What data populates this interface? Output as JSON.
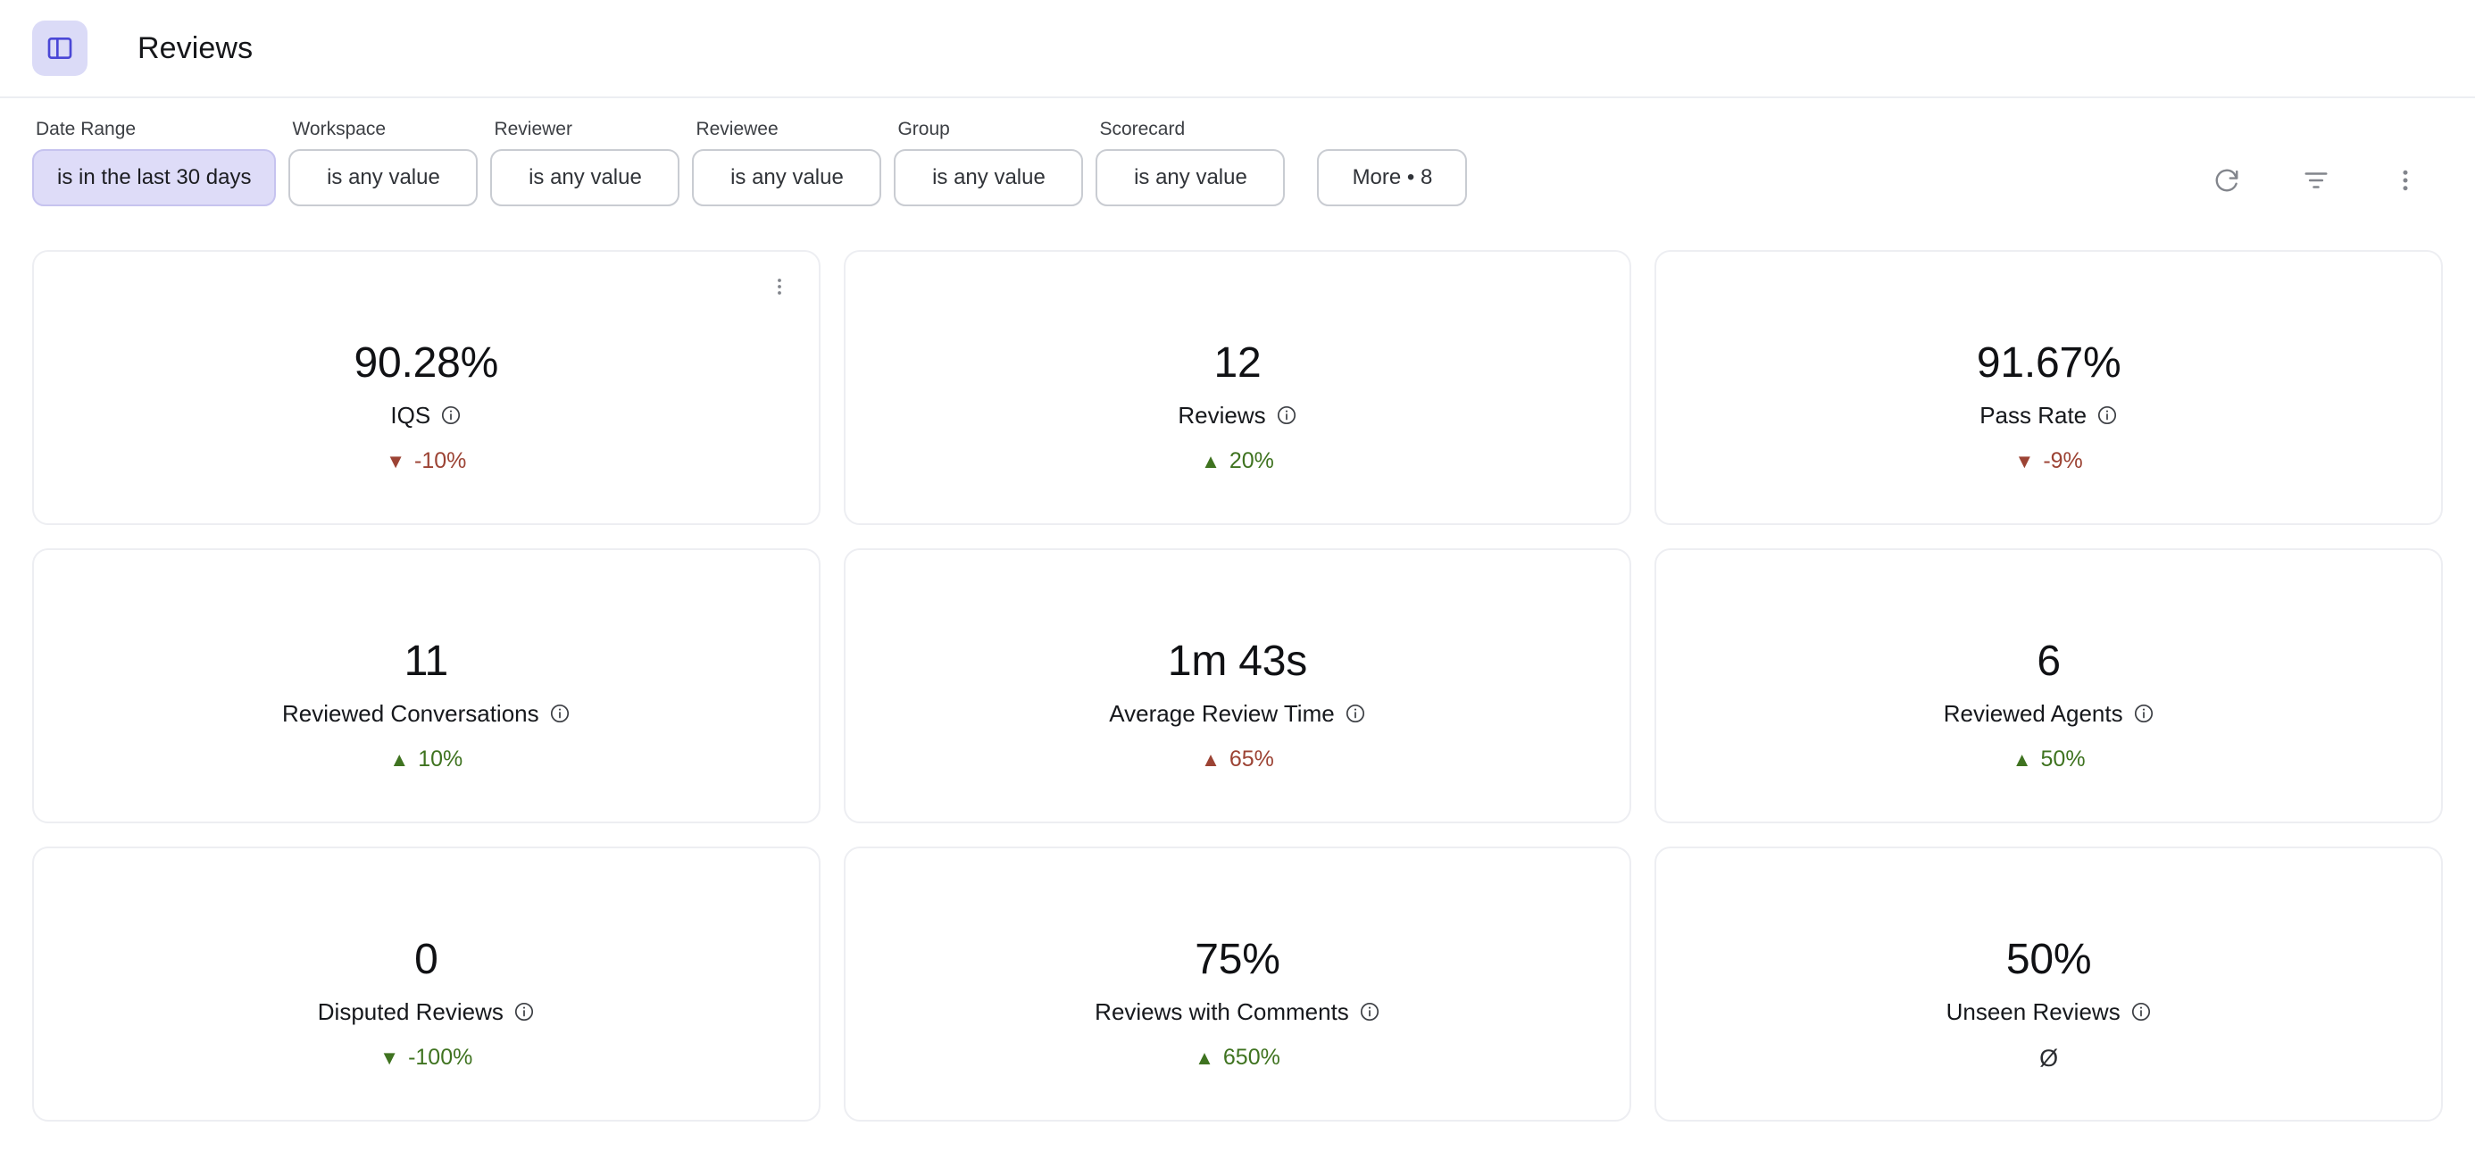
{
  "header": {
    "sidebar_toggle_icon": "panel-left-icon",
    "title": "Reviews"
  },
  "filters": {
    "items": [
      {
        "label": "Date Range",
        "value": "is in the last 30 days",
        "active": true
      },
      {
        "label": "Workspace",
        "value": "is any value",
        "active": false
      },
      {
        "label": "Reviewer",
        "value": "is any value",
        "active": false
      },
      {
        "label": "Reviewee",
        "value": "is any value",
        "active": false
      },
      {
        "label": "Group",
        "value": "is any value",
        "active": false
      },
      {
        "label": "Scorecard",
        "value": "is any value",
        "active": false
      }
    ],
    "more_label": "More • 8",
    "actions": [
      {
        "name": "refresh-icon",
        "label": "Refresh"
      },
      {
        "name": "filter-icon",
        "label": "Filter"
      },
      {
        "name": "more-vertical-icon",
        "label": "More options"
      }
    ]
  },
  "colors": {
    "accent": "#4a47d6",
    "accent_bg": "#dbdbf7",
    "positive": "#3f7320",
    "negative": "#9c4334",
    "neutral": "#2b2d31",
    "card_border": "#edeef2",
    "chip_border": "#c9ccd2"
  },
  "cards": [
    {
      "value": "90.28%",
      "label": "IQS",
      "info_icon": "info-icon",
      "delta": "-10%",
      "arrow": "▼",
      "trend": "down-bad",
      "has_menu": true
    },
    {
      "value": "12",
      "label": "Reviews",
      "info_icon": "info-icon",
      "delta": "20%",
      "arrow": "▲",
      "trend": "up-good",
      "has_menu": false
    },
    {
      "value": "91.67%",
      "label": "Pass Rate",
      "info_icon": "info-icon",
      "delta": "-9%",
      "arrow": "▼",
      "trend": "down-bad",
      "has_menu": false
    },
    {
      "value": "11",
      "label": "Reviewed Conversations",
      "info_icon": "info-icon",
      "delta": "10%",
      "arrow": "▲",
      "trend": "up-good",
      "has_menu": false
    },
    {
      "value": "1m 43s",
      "label": "Average Review Time",
      "info_icon": "info-icon",
      "delta": "65%",
      "arrow": "▲",
      "trend": "up-bad",
      "has_menu": false
    },
    {
      "value": "6",
      "label": "Reviewed Agents",
      "info_icon": "info-icon",
      "delta": "50%",
      "arrow": "▲",
      "trend": "up-good",
      "has_menu": false
    },
    {
      "value": "0",
      "label": "Disputed Reviews",
      "info_icon": "info-icon",
      "delta": "-100%",
      "arrow": "▼",
      "trend": "down-good",
      "has_menu": false
    },
    {
      "value": "75%",
      "label": "Reviews with Comments",
      "info_icon": "info-icon",
      "delta": "650%",
      "arrow": "▲",
      "trend": "up-good",
      "has_menu": false
    },
    {
      "value": "50%",
      "label": "Unseen Reviews",
      "info_icon": "info-icon",
      "delta": "Ø",
      "arrow": "",
      "trend": "neutral",
      "has_menu": false
    }
  ]
}
